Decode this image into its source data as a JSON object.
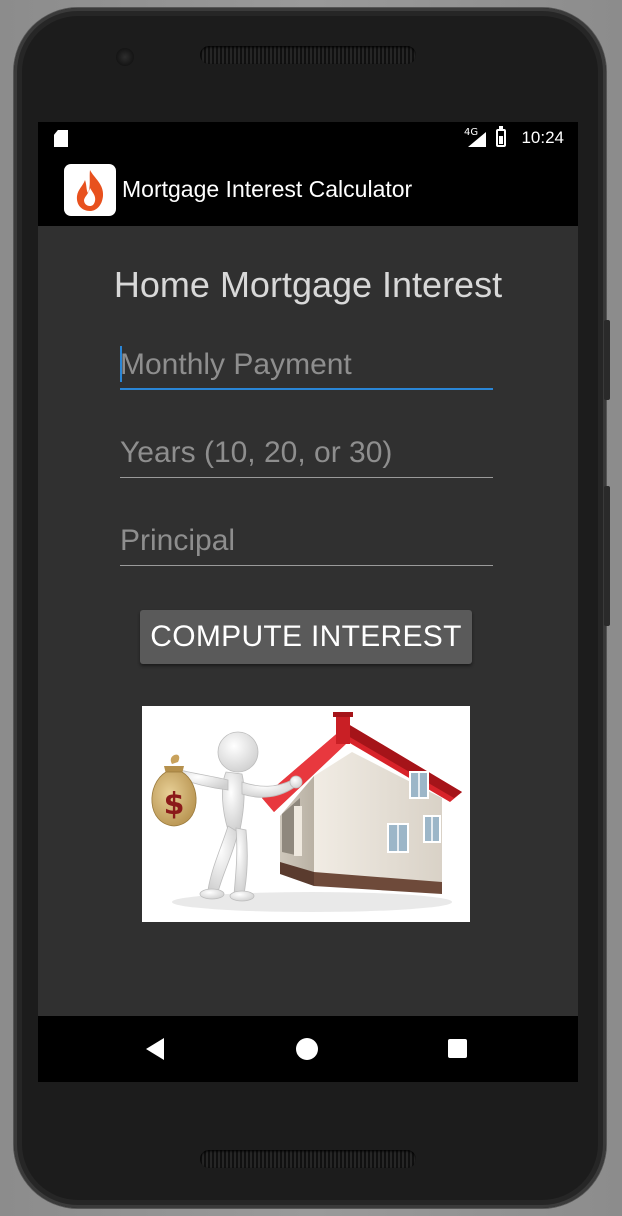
{
  "status_bar": {
    "network": "4G",
    "time": "10:24"
  },
  "app_bar": {
    "title": "Mortgage Interest Calculator",
    "logo_icon": "flame-icon",
    "accent": "#e8511e"
  },
  "main": {
    "heading": "Home Mortgage Interest",
    "fields": [
      {
        "placeholder": "Monthly Payment",
        "value": "",
        "focused": true
      },
      {
        "placeholder": "Years (10, 20, or 30)",
        "value": ""
      },
      {
        "placeholder": "Principal",
        "value": ""
      }
    ],
    "compute_button_label": "COMPUTE INTEREST",
    "illustration": {
      "description_icon": "house-with-money-bag-illustration",
      "money_bag_symbol": "$"
    }
  },
  "nav_bar": {
    "back_icon": "back-triangle-icon",
    "home_icon": "home-circle-icon",
    "recents_icon": "recents-square-icon"
  },
  "colors": {
    "focus_underline": "#2a86d6",
    "roof": "#d8232a",
    "background": "#303030"
  }
}
